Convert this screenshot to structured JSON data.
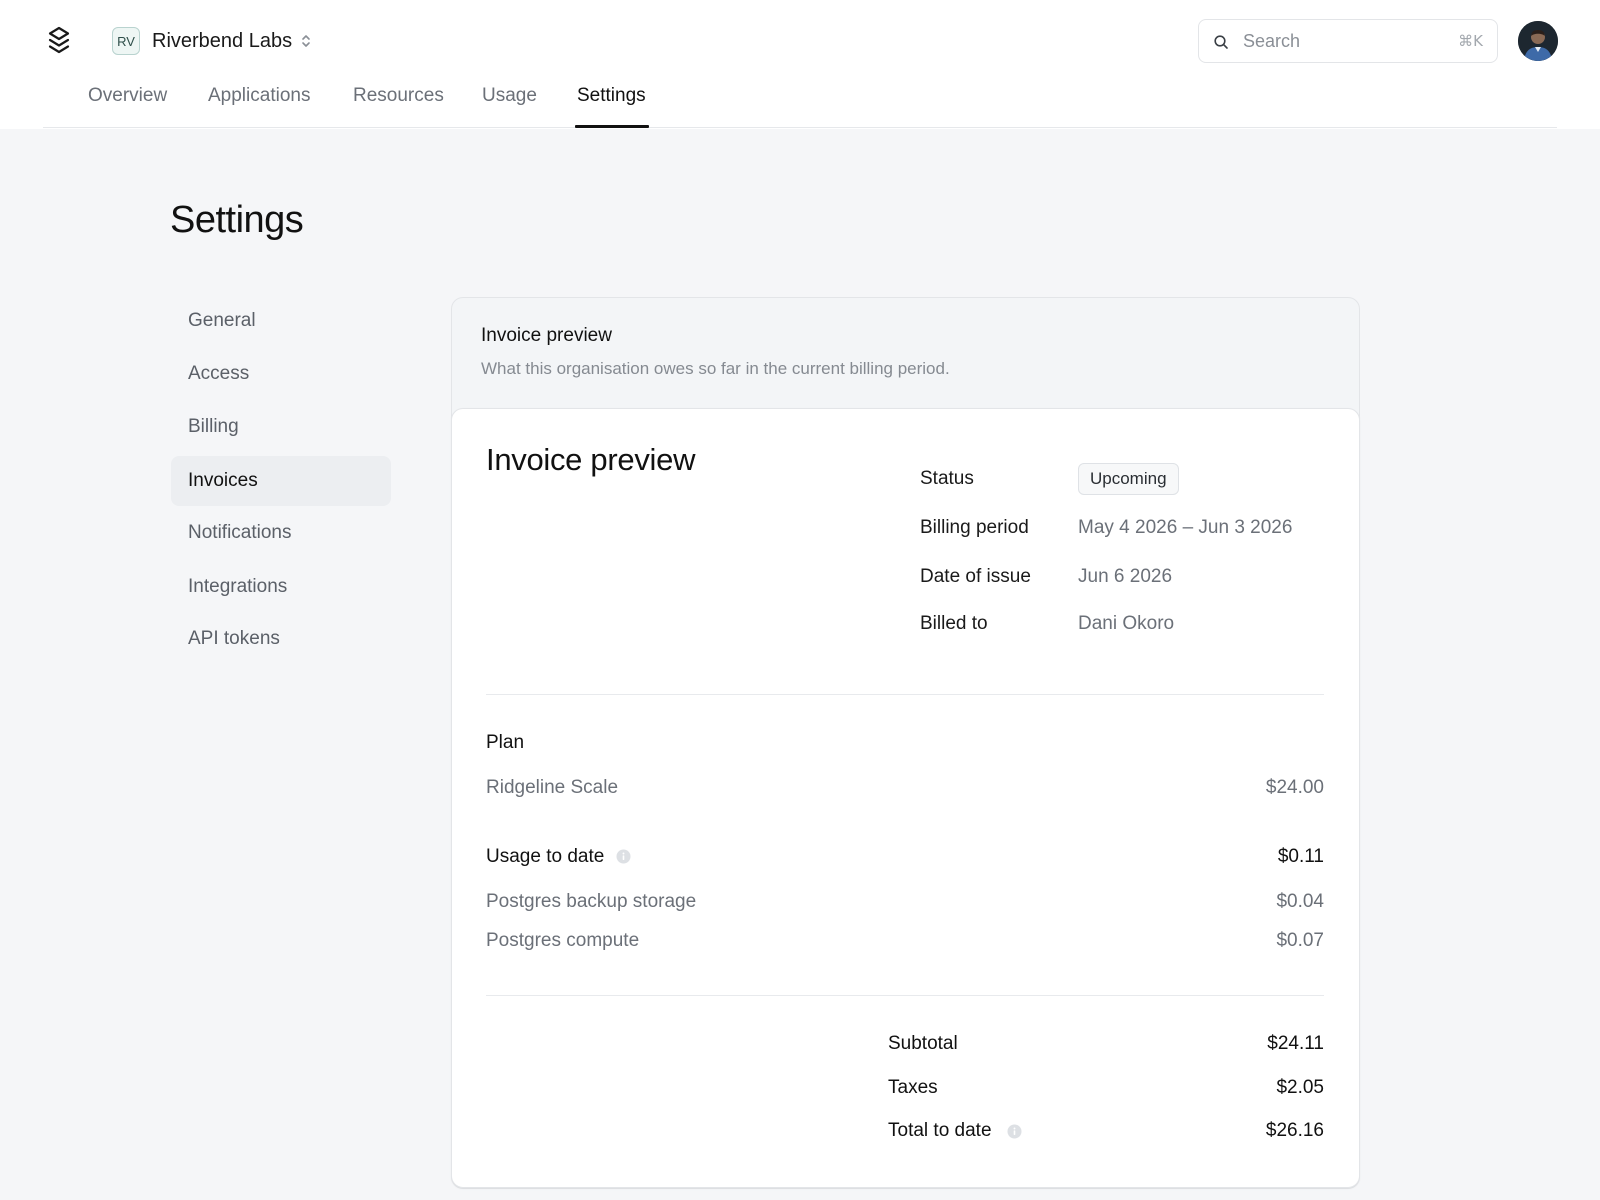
{
  "header": {
    "org_badge": "RV",
    "org_name": "Riverbend Labs",
    "search": {
      "placeholder": "Search",
      "shortcut": "⌘K"
    },
    "tabs": [
      {
        "label": "Overview",
        "active": false
      },
      {
        "label": "Applications",
        "active": false
      },
      {
        "label": "Resources",
        "active": false
      },
      {
        "label": "Usage",
        "active": false
      },
      {
        "label": "Settings",
        "active": true
      }
    ]
  },
  "page": {
    "title": "Settings"
  },
  "subnav": {
    "items": [
      {
        "label": "General",
        "active": false
      },
      {
        "label": "Access",
        "active": false
      },
      {
        "label": "Billing",
        "active": false
      },
      {
        "label": "Invoices",
        "active": true
      },
      {
        "label": "Notifications",
        "active": false
      },
      {
        "label": "Integrations",
        "active": false
      },
      {
        "label": "API tokens",
        "active": false
      }
    ]
  },
  "section": {
    "title": "Invoice preview",
    "description": "What this organisation owes so far in the current billing period."
  },
  "invoice": {
    "title": "Invoice preview",
    "status_label": "Status",
    "status_value": "Upcoming",
    "billing_period_label": "Billing period",
    "billing_period_value": "May 4 2026 – Jun 3 2026",
    "date_of_issue_label": "Date of issue",
    "date_of_issue_value": "Jun 6 2026",
    "billed_to_label": "Billed to",
    "billed_to_value": "Dani Okoro",
    "plan": {
      "heading": "Plan",
      "name": "Ridgeline Scale",
      "amount": "$24.00"
    },
    "usage": {
      "heading": "Usage to date",
      "total": "$0.11",
      "items": [
        {
          "label": "Postgres backup storage",
          "amount": "$0.04"
        },
        {
          "label": "Postgres compute",
          "amount": "$0.07"
        }
      ]
    },
    "totals": {
      "subtotal_label": "Subtotal",
      "subtotal": "$24.11",
      "taxes_label": "Taxes",
      "taxes": "$2.05",
      "total_label": "Total to date",
      "total": "$26.16"
    }
  },
  "colors": {
    "background": "#f5f6f8",
    "surface": "#ffffff",
    "text_primary": "#111111",
    "text_muted": "#6b7078",
    "border": "#e3e5e8",
    "org_badge_bg": "#eef6f4"
  }
}
